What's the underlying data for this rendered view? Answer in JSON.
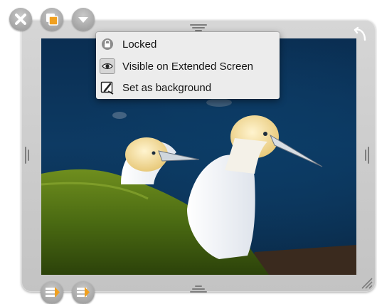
{
  "menu": {
    "items": [
      {
        "label": "Locked",
        "icon": "lock-icon"
      },
      {
        "label": "Visible on Extended Screen",
        "icon": "eye-icon"
      },
      {
        "label": "Set as background",
        "icon": "background-brush-icon"
      }
    ]
  },
  "toolbar": {
    "buttons": [
      "close-icon",
      "duplicate-icon",
      "chevron-down-icon"
    ]
  },
  "bottom_buttons": [
    "layer-back-icon",
    "layer-forward-icon"
  ],
  "photo": {
    "subject": "image"
  },
  "colors": {
    "frame": "#c8c8c8",
    "button": "#a0a0a0",
    "accent_orange": "#f0a020",
    "menu_bg": "#ececec"
  }
}
